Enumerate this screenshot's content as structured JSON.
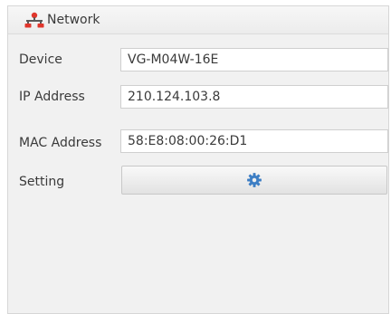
{
  "panel": {
    "title": "Network",
    "icon": "network-icon"
  },
  "fields": {
    "device": {
      "label": "Device",
      "value": "VG-M04W-16E"
    },
    "ip_address": {
      "label": "IP Address",
      "value": "210.124.103.8"
    },
    "mac_address": {
      "label": "MAC Address",
      "value": "58:E8:08:00:26:D1"
    }
  },
  "setting": {
    "label": "Setting",
    "button_icon": "gear-icon"
  },
  "colors": {
    "icon_red": "#e0362c",
    "gear_blue": "#3d7ec4",
    "panel_bg": "#f1f1f1"
  }
}
